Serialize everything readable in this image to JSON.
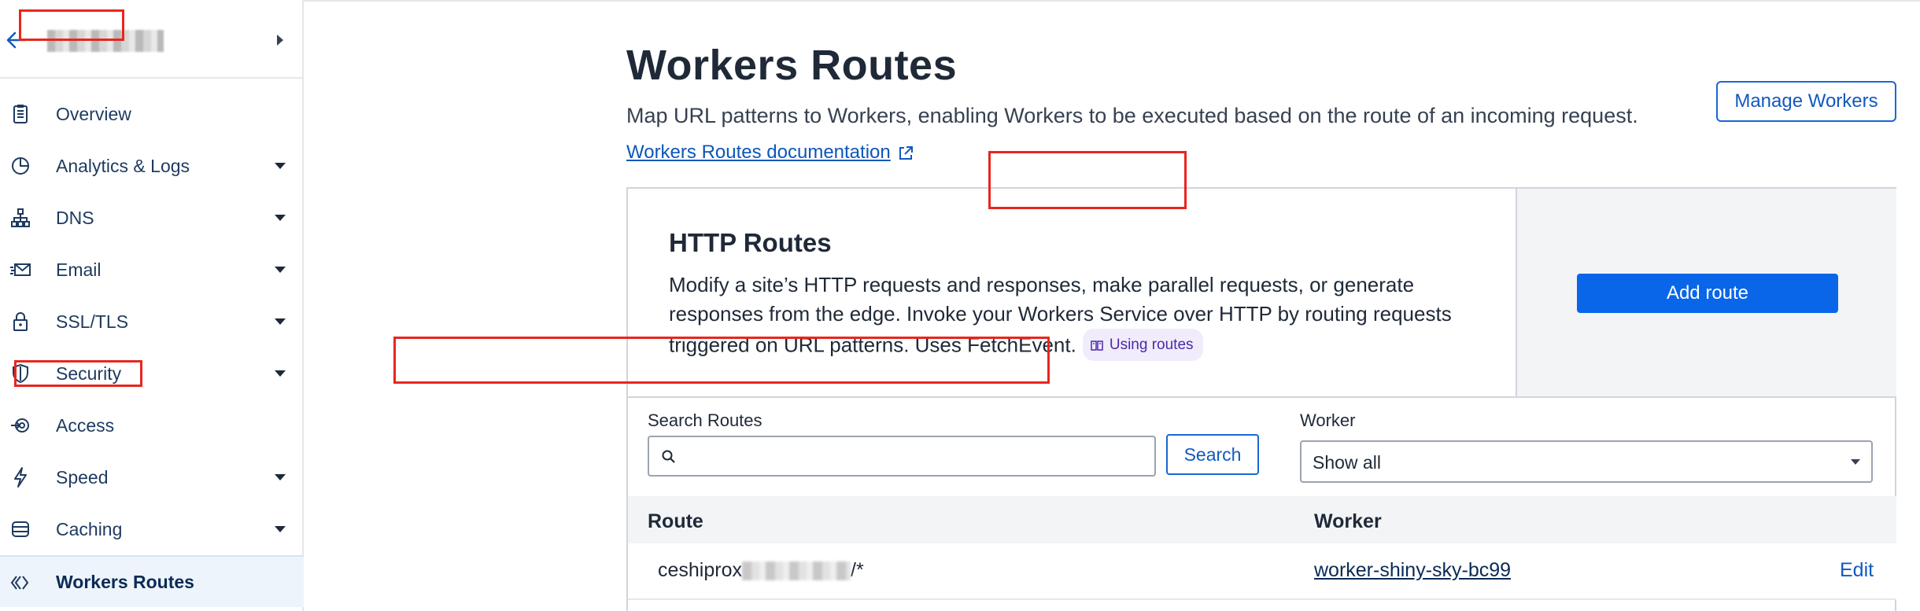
{
  "sidebar": {
    "site_name": "",
    "items": [
      {
        "label": "Overview",
        "icon": "clipboard-icon",
        "has_caret": false
      },
      {
        "label": "Analytics & Logs",
        "icon": "pie-chart-icon",
        "has_caret": true
      },
      {
        "label": "DNS",
        "icon": "network-icon",
        "has_caret": true
      },
      {
        "label": "Email",
        "icon": "envelope-icon",
        "has_caret": true
      },
      {
        "label": "SSL/TLS",
        "icon": "lock-icon",
        "has_caret": true
      },
      {
        "label": "Security",
        "icon": "shield-icon",
        "has_caret": true
      },
      {
        "label": "Access",
        "icon": "access-icon",
        "has_caret": false
      },
      {
        "label": "Speed",
        "icon": "lightning-icon",
        "has_caret": true
      },
      {
        "label": "Caching",
        "icon": "database-icon",
        "has_caret": true
      },
      {
        "label": "Workers Routes",
        "icon": "workers-icon",
        "has_caret": false,
        "active": true
      }
    ]
  },
  "header": {
    "title": "Workers Routes",
    "description": "Map URL patterns to Workers, enabling Workers to be executed based on the route of an incoming request.",
    "doc_link": "Workers Routes documentation",
    "manage_button": "Manage Workers"
  },
  "http_routes": {
    "title": "HTTP Routes",
    "description": "Modify a site’s HTTP requests and responses, make parallel requests, or generate responses from the edge. Invoke your Workers Service over HTTP by routing requests triggered on URL patterns. Uses FetchEvent.",
    "pill": "Using routes",
    "add_button": "Add route"
  },
  "filters": {
    "search_label": "Search Routes",
    "search_value": "",
    "search_button": "Search",
    "worker_label": "Worker",
    "worker_selected": "Show all"
  },
  "table": {
    "columns": [
      "Route",
      "Worker"
    ],
    "rows": [
      {
        "route_prefix": "ceshiprox",
        "route_suffix": "/*",
        "worker": "worker-shiny-sky-bc99",
        "action": "Edit"
      }
    ]
  },
  "colors": {
    "accent": "#0a66e8",
    "link": "#1259bf",
    "annotation": "#e8261e",
    "active_bg": "#eef4fb"
  }
}
